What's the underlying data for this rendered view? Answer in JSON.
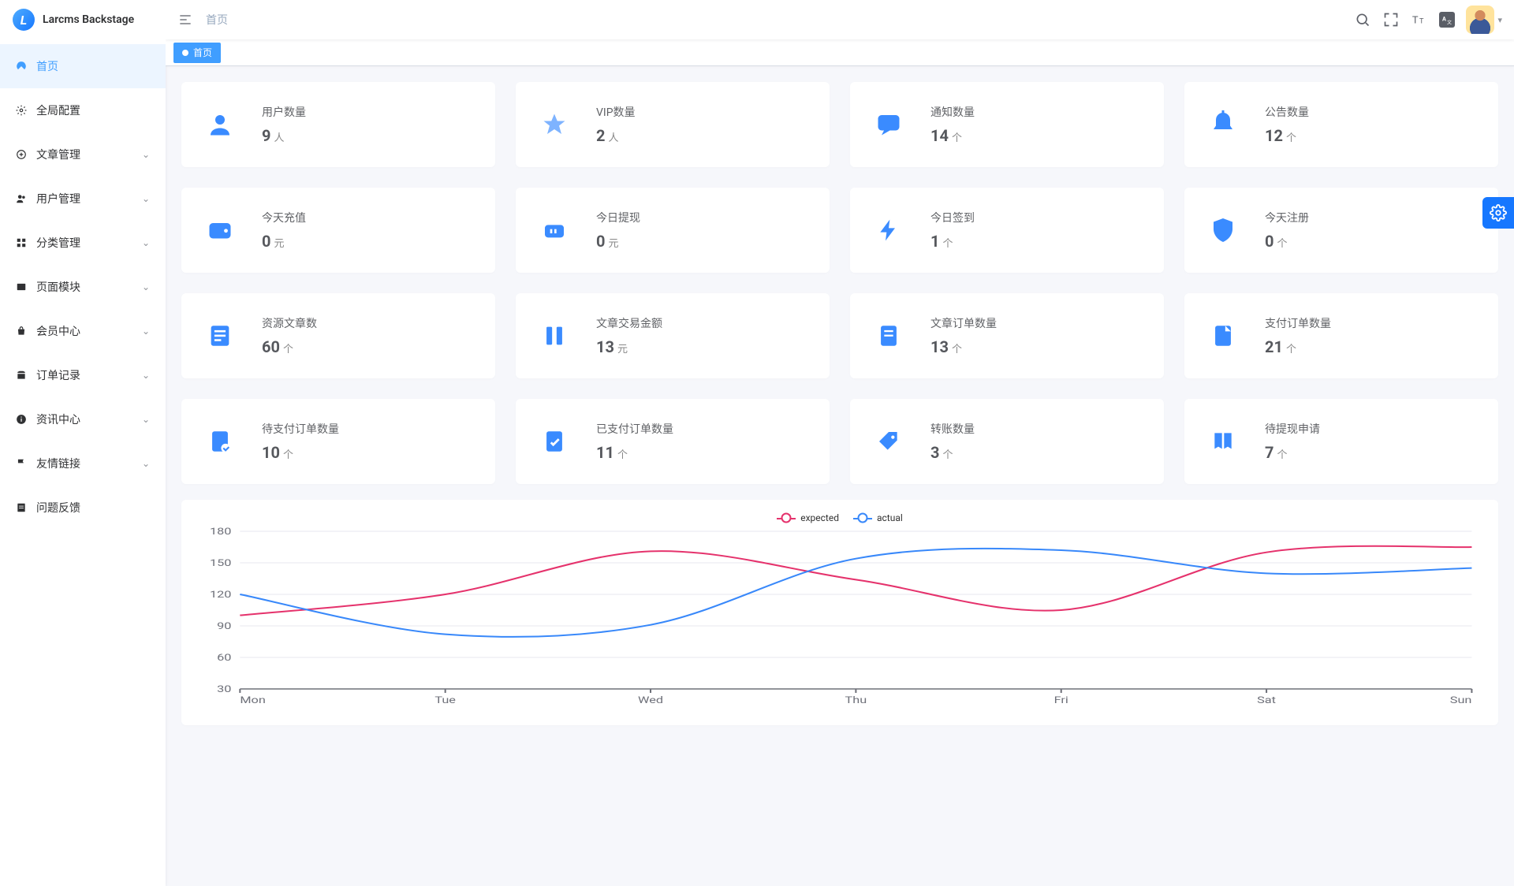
{
  "app_name": "Larcms Backstage",
  "breadcrumb": "首页",
  "tabs": [
    {
      "label": "首页"
    }
  ],
  "sidebar": {
    "items": [
      {
        "label": "首页",
        "icon": "dashboard",
        "expandable": false,
        "active": true
      },
      {
        "label": "全局配置",
        "icon": "gear",
        "expandable": false
      },
      {
        "label": "文章管理",
        "icon": "article",
        "expandable": true
      },
      {
        "label": "用户管理",
        "icon": "users",
        "expandable": true
      },
      {
        "label": "分类管理",
        "icon": "category",
        "expandable": true
      },
      {
        "label": "页面模块",
        "icon": "page",
        "expandable": true
      },
      {
        "label": "会员中心",
        "icon": "member",
        "expandable": true
      },
      {
        "label": "订单记录",
        "icon": "order",
        "expandable": true
      },
      {
        "label": "资讯中心",
        "icon": "info",
        "expandable": true
      },
      {
        "label": "友情链接",
        "icon": "flag",
        "expandable": true
      },
      {
        "label": "问题反馈",
        "icon": "feedback",
        "expandable": false
      }
    ]
  },
  "cards": [
    {
      "title": "用户数量",
      "value": "9",
      "unit": "人",
      "icon": "user"
    },
    {
      "title": "VIP数量",
      "value": "2",
      "unit": "人",
      "icon": "vip"
    },
    {
      "title": "通知数量",
      "value": "14",
      "unit": "个",
      "icon": "chat"
    },
    {
      "title": "公告数量",
      "value": "12",
      "unit": "个",
      "icon": "bell"
    },
    {
      "title": "今天充值",
      "value": "0",
      "unit": "元",
      "icon": "wallet"
    },
    {
      "title": "今日提现",
      "value": "0",
      "unit": "元",
      "icon": "withdraw"
    },
    {
      "title": "今日签到",
      "value": "1",
      "unit": "个",
      "icon": "bolt"
    },
    {
      "title": "今天注册",
      "value": "0",
      "unit": "个",
      "icon": "shield"
    },
    {
      "title": "资源文章数",
      "value": "60",
      "unit": "个",
      "icon": "doc"
    },
    {
      "title": "文章交易金额",
      "value": "13",
      "unit": "元",
      "icon": "cols"
    },
    {
      "title": "文章订单数量",
      "value": "13",
      "unit": "个",
      "icon": "file"
    },
    {
      "title": "支付订单数量",
      "value": "21",
      "unit": "个",
      "icon": "file2"
    },
    {
      "title": "待支付订单数量",
      "value": "10",
      "unit": "个",
      "icon": "file3"
    },
    {
      "title": "已支付订单数量",
      "value": "11",
      "unit": "个",
      "icon": "file4"
    },
    {
      "title": "转账数量",
      "value": "3",
      "unit": "个",
      "icon": "tag"
    },
    {
      "title": "待提现申请",
      "value": "7",
      "unit": "个",
      "icon": "book"
    }
  ],
  "legend": {
    "expected": "expected",
    "actual": "actual"
  },
  "chart_data": {
    "type": "line",
    "categories": [
      "Mon",
      "Tue",
      "Wed",
      "Thu",
      "Fri",
      "Sat",
      "Sun"
    ],
    "series": [
      {
        "name": "expected",
        "values": [
          100,
          120,
          161,
          134,
          105,
          160,
          165
        ],
        "color": "#e5326c"
      },
      {
        "name": "actual",
        "values": [
          120,
          82,
          91,
          154,
          162,
          140,
          145
        ],
        "color": "#3888fa"
      }
    ],
    "yticks": [
      30,
      60,
      90,
      120,
      150,
      180
    ],
    "ylabel": "",
    "xlabel": "",
    "ylim": [
      30,
      180
    ],
    "title": "",
    "legend_pos": "top"
  }
}
